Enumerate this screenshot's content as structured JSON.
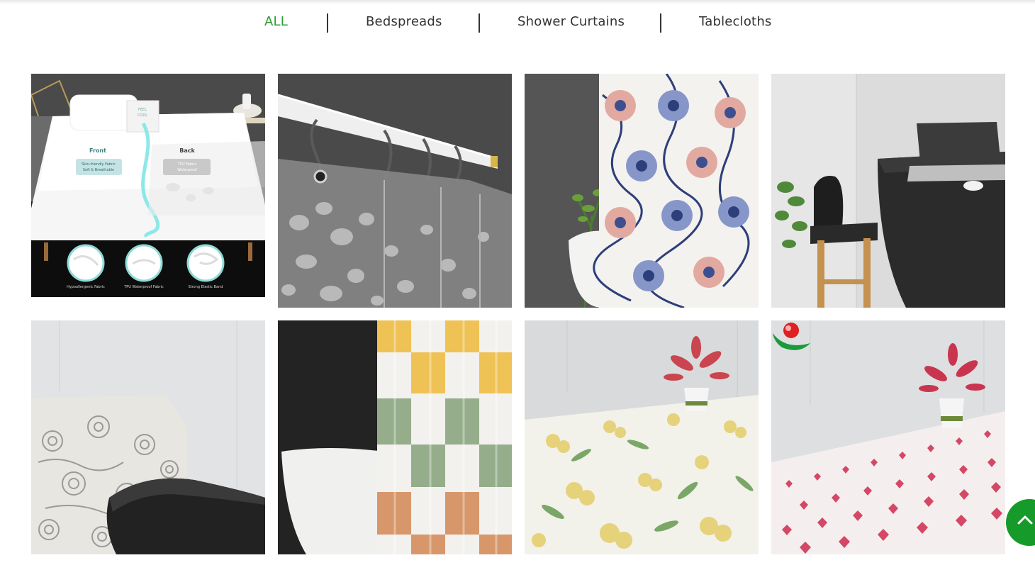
{
  "category_tabs": [
    {
      "label": "ALL",
      "active": true
    },
    {
      "label": "Bedspreads",
      "active": false
    },
    {
      "label": "Shower Curtains",
      "active": false
    },
    {
      "label": "Tablecloths",
      "active": false
    }
  ],
  "products": {
    "mattress_protector": {
      "category": "Bedspreads",
      "front_title": "Front",
      "front_desc_1": "Skin-friendly Fabric",
      "front_desc_2": "Soft & Breathable",
      "back_title": "Back",
      "back_desc_1": "TPU Fabric",
      "back_desc_2": "Waterproof",
      "pillow_text_1": "FEEL",
      "pillow_text_2": "COOL",
      "feature_1": "Hypoallergenic Fabric",
      "feature_2": "TPU Waterproof Fabric",
      "feature_3": "Strong Elastic Band"
    },
    "clear_pebble_curtain": {
      "category": "Shower Curtains"
    },
    "blue_floral_curtain": {
      "category": "Shower Curtains"
    },
    "black_tablecloth": {
      "category": "Tablecloths"
    },
    "grey_floral_tablecloth": {
      "category": "Tablecloths"
    },
    "checkered_curtain": {
      "category": "Shower Curtains"
    },
    "yellow_floral_tablecloth": {
      "category": "Tablecloths"
    },
    "red_heart_tablecloth": {
      "category": "Tablecloths"
    }
  },
  "scroll_top": {
    "icon": "chevron-up-icon"
  },
  "colors": {
    "accent": "#2e9b33",
    "scroll_button": "#169a29",
    "text": "#333333"
  }
}
